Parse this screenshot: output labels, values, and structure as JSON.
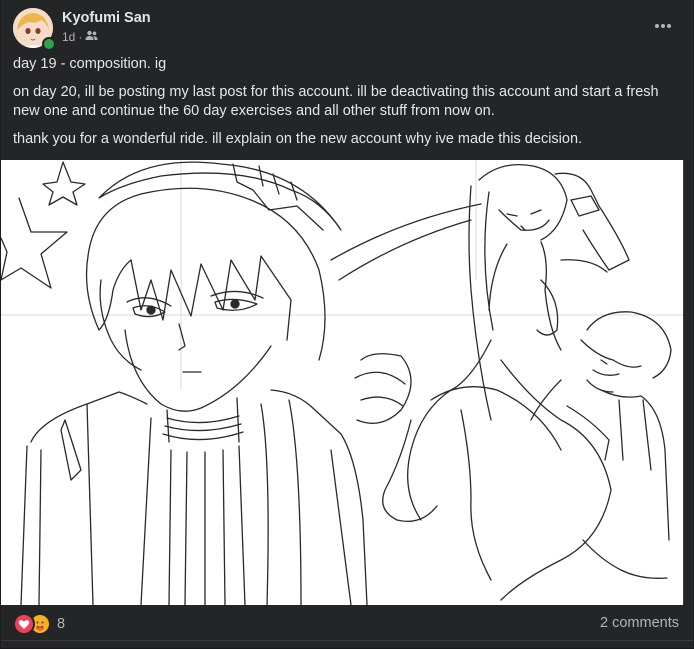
{
  "post": {
    "author": "Kyofumi San",
    "time": "1d",
    "audience_icon": "friends-icon",
    "paragraphs": [
      "day 19 - composition. ig",
      "on day 20, ill be posting my last post for this account. ill be deactivating this account and start a fresh new one and continue the 60 day exercises and all other stuff from now on.",
      "thank you for a wonderful ride. ill explain on the new account why ive made this decision."
    ],
    "more_icon": "more-options-icon"
  },
  "footer": {
    "reaction_icons": [
      "love-reaction-icon",
      "care-reaction-icon"
    ],
    "reaction_count": "8",
    "comments_label": "2 comments"
  },
  "colors": {
    "card_bg": "#242526",
    "text_primary": "#e4e6eb",
    "text_secondary": "#b0b3b8",
    "online": "#31a24c",
    "love": "#f33e58",
    "care": "#f7b125"
  }
}
